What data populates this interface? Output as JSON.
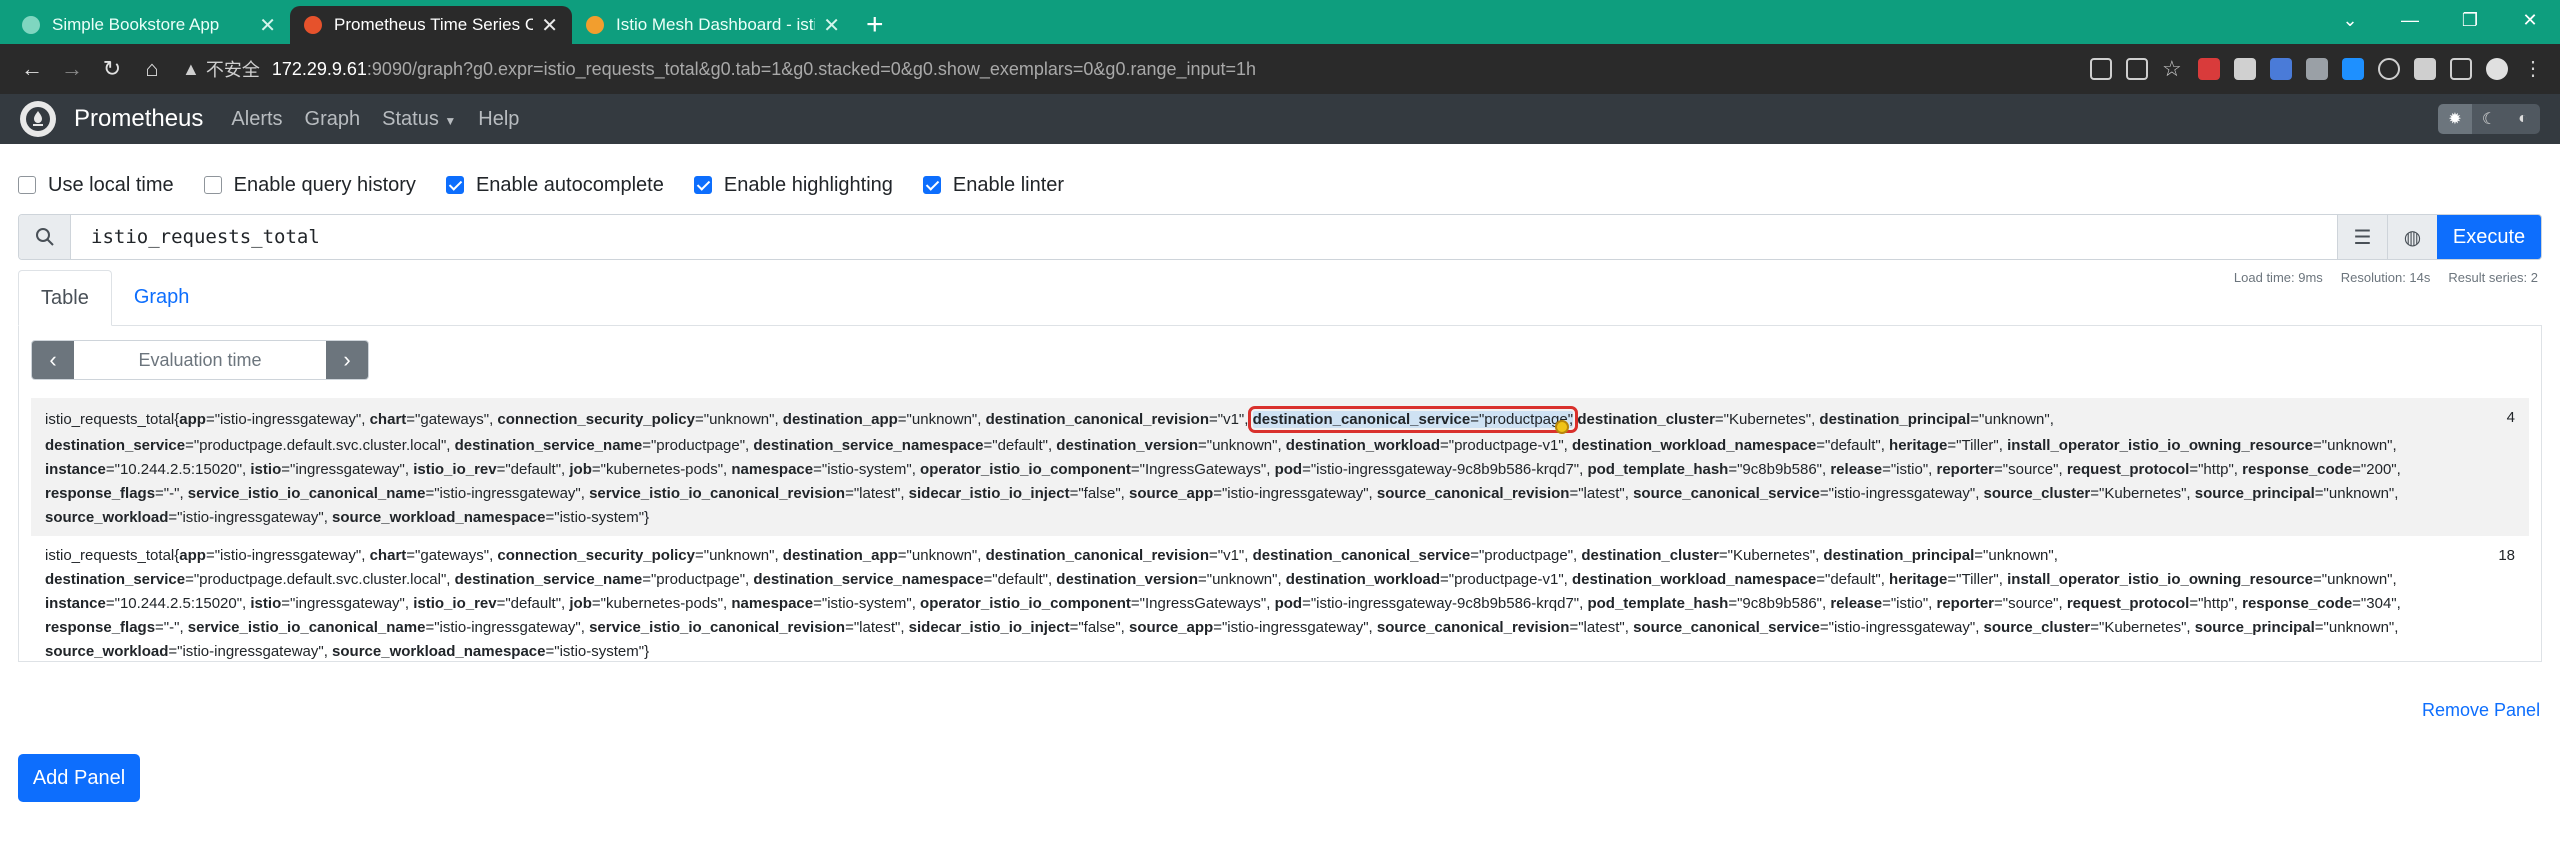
{
  "browser": {
    "tabs": [
      {
        "title": "Simple Bookstore App",
        "active": false
      },
      {
        "title": "Prometheus Time Series Colle",
        "active": true
      },
      {
        "title": "Istio Mesh Dashboard - istio",
        "active": false
      }
    ],
    "new_tab": "+",
    "window_controls": [
      "⌄",
      "—",
      "❐",
      "✕"
    ],
    "security_label": "不安全",
    "url_host": "172.29.9.61",
    "url_rest": ":9090/graph?g0.expr=istio_requests_total&g0.tab=1&g0.stacked=0&g0.show_exemplars=0&g0.range_input=1h"
  },
  "nav": {
    "brand": "Prometheus",
    "links": [
      "Alerts",
      "Graph",
      "Status",
      "Help"
    ]
  },
  "options": [
    {
      "label": "Use local time",
      "checked": false
    },
    {
      "label": "Enable query history",
      "checked": false
    },
    {
      "label": "Enable autocomplete",
      "checked": true
    },
    {
      "label": "Enable highlighting",
      "checked": true
    },
    {
      "label": "Enable linter",
      "checked": true
    }
  ],
  "query": {
    "expression": "istio_requests_total",
    "execute_label": "Execute"
  },
  "panel": {
    "tabs": [
      "Table",
      "Graph"
    ],
    "stats": {
      "load_time": "Load time: 9ms",
      "resolution": "Resolution: 14s",
      "result_series": "Result series: 2"
    },
    "evaluation_time_placeholder": "Evaluation time",
    "results": [
      {
        "metric": "istio_requests_total",
        "labels": [
          [
            "app",
            "istio-ingressgateway"
          ],
          [
            "chart",
            "gateways"
          ],
          [
            "connection_security_policy",
            "unknown"
          ],
          [
            "destination_app",
            "unknown"
          ],
          [
            "destination_canonical_revision",
            "v1"
          ],
          [
            "destination_canonical_service",
            "productpage"
          ],
          [
            "destination_cluster",
            "Kubernetes"
          ],
          [
            "destination_principal",
            "unknown"
          ],
          [
            "destination_service",
            "productpage.default.svc.cluster.local"
          ],
          [
            "destination_service_name",
            "productpage"
          ],
          [
            "destination_service_namespace",
            "default"
          ],
          [
            "destination_version",
            "unknown"
          ],
          [
            "destination_workload",
            "productpage-v1"
          ],
          [
            "destination_workload_namespace",
            "default"
          ],
          [
            "heritage",
            "Tiller"
          ],
          [
            "install_operator_istio_io_owning_resource",
            "unknown"
          ],
          [
            "instance",
            "10.244.2.5:15020"
          ],
          [
            "istio",
            "ingressgateway"
          ],
          [
            "istio_io_rev",
            "default"
          ],
          [
            "job",
            "kubernetes-pods"
          ],
          [
            "namespace",
            "istio-system"
          ],
          [
            "operator_istio_io_component",
            "IngressGateways"
          ],
          [
            "pod",
            "istio-ingressgateway-9c8b9b586-krqd7"
          ],
          [
            "pod_template_hash",
            "9c8b9b586"
          ],
          [
            "release",
            "istio"
          ],
          [
            "reporter",
            "source"
          ],
          [
            "request_protocol",
            "http"
          ],
          [
            "response_code",
            "200"
          ],
          [
            "response_flags",
            "-"
          ],
          [
            "service_istio_io_canonical_name",
            "istio-ingressgateway"
          ],
          [
            "service_istio_io_canonical_revision",
            "latest"
          ],
          [
            "sidecar_istio_io_inject",
            "false"
          ],
          [
            "source_app",
            "istio-ingressgateway"
          ],
          [
            "source_canonical_revision",
            "latest"
          ],
          [
            "source_canonical_service",
            "istio-ingressgateway"
          ],
          [
            "source_cluster",
            "Kubernetes"
          ],
          [
            "source_principal",
            "unknown"
          ],
          [
            "source_workload",
            "istio-ingressgateway"
          ],
          [
            "source_workload_namespace",
            "istio-system"
          ]
        ],
        "value": "4"
      },
      {
        "metric": "istio_requests_total",
        "labels": [
          [
            "app",
            "istio-ingressgateway"
          ],
          [
            "chart",
            "gateways"
          ],
          [
            "connection_security_policy",
            "unknown"
          ],
          [
            "destination_app",
            "unknown"
          ],
          [
            "destination_canonical_revision",
            "v1"
          ],
          [
            "destination_canonical_service",
            "productpage"
          ],
          [
            "destination_cluster",
            "Kubernetes"
          ],
          [
            "destination_principal",
            "unknown"
          ],
          [
            "destination_service",
            "productpage.default.svc.cluster.local"
          ],
          [
            "destination_service_name",
            "productpage"
          ],
          [
            "destination_service_namespace",
            "default"
          ],
          [
            "destination_version",
            "unknown"
          ],
          [
            "destination_workload",
            "productpage-v1"
          ],
          [
            "destination_workload_namespace",
            "default"
          ],
          [
            "heritage",
            "Tiller"
          ],
          [
            "install_operator_istio_io_owning_resource",
            "unknown"
          ],
          [
            "instance",
            "10.244.2.5:15020"
          ],
          [
            "istio",
            "ingressgateway"
          ],
          [
            "istio_io_rev",
            "default"
          ],
          [
            "job",
            "kubernetes-pods"
          ],
          [
            "namespace",
            "istio-system"
          ],
          [
            "operator_istio_io_component",
            "IngressGateways"
          ],
          [
            "pod",
            "istio-ingressgateway-9c8b9b586-krqd7"
          ],
          [
            "pod_template_hash",
            "9c8b9b586"
          ],
          [
            "release",
            "istio"
          ],
          [
            "reporter",
            "source"
          ],
          [
            "request_protocol",
            "http"
          ],
          [
            "response_code",
            "304"
          ],
          [
            "response_flags",
            "-"
          ],
          [
            "service_istio_io_canonical_name",
            "istio-ingressgateway"
          ],
          [
            "service_istio_io_canonical_revision",
            "latest"
          ],
          [
            "sidecar_istio_io_inject",
            "false"
          ],
          [
            "source_app",
            "istio-ingressgateway"
          ],
          [
            "source_canonical_revision",
            "latest"
          ],
          [
            "source_canonical_service",
            "istio-ingressgateway"
          ],
          [
            "source_cluster",
            "Kubernetes"
          ],
          [
            "source_principal",
            "unknown"
          ],
          [
            "source_workload",
            "istio-ingressgateway"
          ],
          [
            "source_workload_namespace",
            "istio-system"
          ]
        ],
        "value": "18"
      }
    ],
    "remove_label": "Remove Panel"
  },
  "add_panel_label": "Add Panel",
  "colors": {
    "tabbar": "#0e9e7e",
    "prom_nav": "#343a40",
    "primary": "#0d6efd",
    "highlight_box": "#d9302c"
  }
}
